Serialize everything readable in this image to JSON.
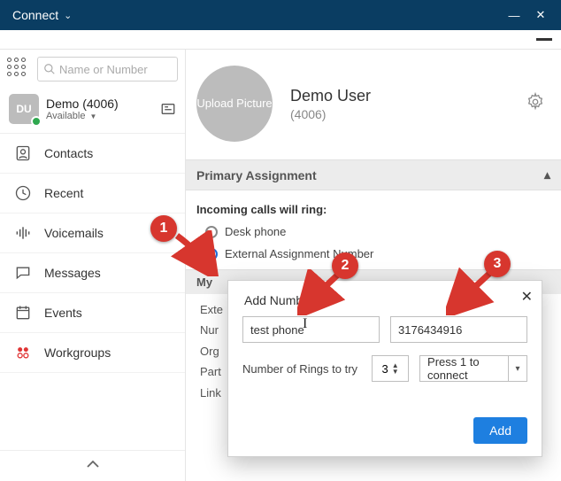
{
  "window": {
    "title": "Connect"
  },
  "search": {
    "placeholder": "Name or Number"
  },
  "me": {
    "initials": "DU",
    "name": "Demo (4006)",
    "status": "Available",
    "status_arrow": "▼"
  },
  "nav": {
    "contacts": "Contacts",
    "recent": "Recent",
    "voicemails": "Voicemails",
    "messages": "Messages",
    "events": "Events",
    "workgroups": "Workgroups"
  },
  "profile": {
    "upload_label": "Upload Picture",
    "name": "Demo User",
    "extension": "(4006)"
  },
  "primary": {
    "header": "Primary Assignment",
    "incoming_label": "Incoming calls will ring:",
    "opt_desk": "Desk phone",
    "opt_external": "External Assignment Number"
  },
  "my_section": {
    "header": "My",
    "row1": "Exte",
    "row2": "Nur",
    "row3": "Org",
    "row4": "Part",
    "row5": "Link"
  },
  "popup": {
    "title": "Add Number",
    "label_value": "test phone",
    "number_value": "3176434916",
    "rings_label": "Number of Rings to try",
    "rings_value": "3",
    "connect_option": "Press 1 to connect",
    "add_button": "Add"
  },
  "anno": {
    "n1": "1",
    "n2": "2",
    "n3": "3"
  }
}
